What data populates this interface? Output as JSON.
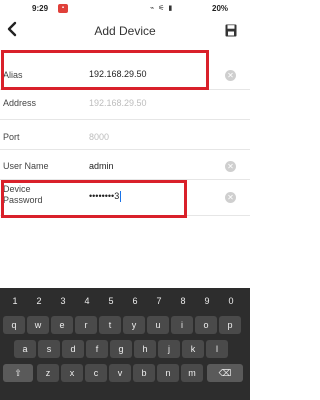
{
  "status_bar": {
    "time": "9:29",
    "notification_badge": "▪",
    "signal_icons": "⌁ ⚟ ▮",
    "battery": "20%"
  },
  "app_bar": {
    "title": "Add Device",
    "back_icon": "back-arrow-icon",
    "save_icon": "save-icon"
  },
  "form": {
    "fields": [
      {
        "label": "Alias",
        "value": "192.168.29.50",
        "is_placeholder": false,
        "has_clear": true
      },
      {
        "label": "Address",
        "value": "192.168.29.50",
        "is_placeholder": true,
        "has_clear": false
      },
      {
        "label": "Port",
        "value": "8000",
        "is_placeholder": true,
        "has_clear": false
      },
      {
        "label": "User Name",
        "value": "admin",
        "is_placeholder": false,
        "has_clear": true
      },
      {
        "label": "Device\nPassword",
        "value": "••••••••3",
        "is_placeholder": false,
        "has_clear": true
      }
    ]
  },
  "keyboard": {
    "number_row": [
      "1",
      "2",
      "3",
      "4",
      "5",
      "6",
      "7",
      "8",
      "9",
      "0"
    ],
    "row1": [
      "q",
      "w",
      "e",
      "r",
      "t",
      "y",
      "u",
      "i",
      "o",
      "p"
    ],
    "row2": [
      "a",
      "s",
      "d",
      "f",
      "g",
      "h",
      "j",
      "k",
      "l"
    ],
    "row3": [
      "z",
      "x",
      "c",
      "v",
      "b",
      "n",
      "m"
    ],
    "shift_icon": "⇧",
    "delete_icon": "⌫"
  },
  "colors": {
    "highlight": "#d9202a",
    "keyboard_bg": "#2d2d2d",
    "key_bg": "#4a4a4a"
  }
}
